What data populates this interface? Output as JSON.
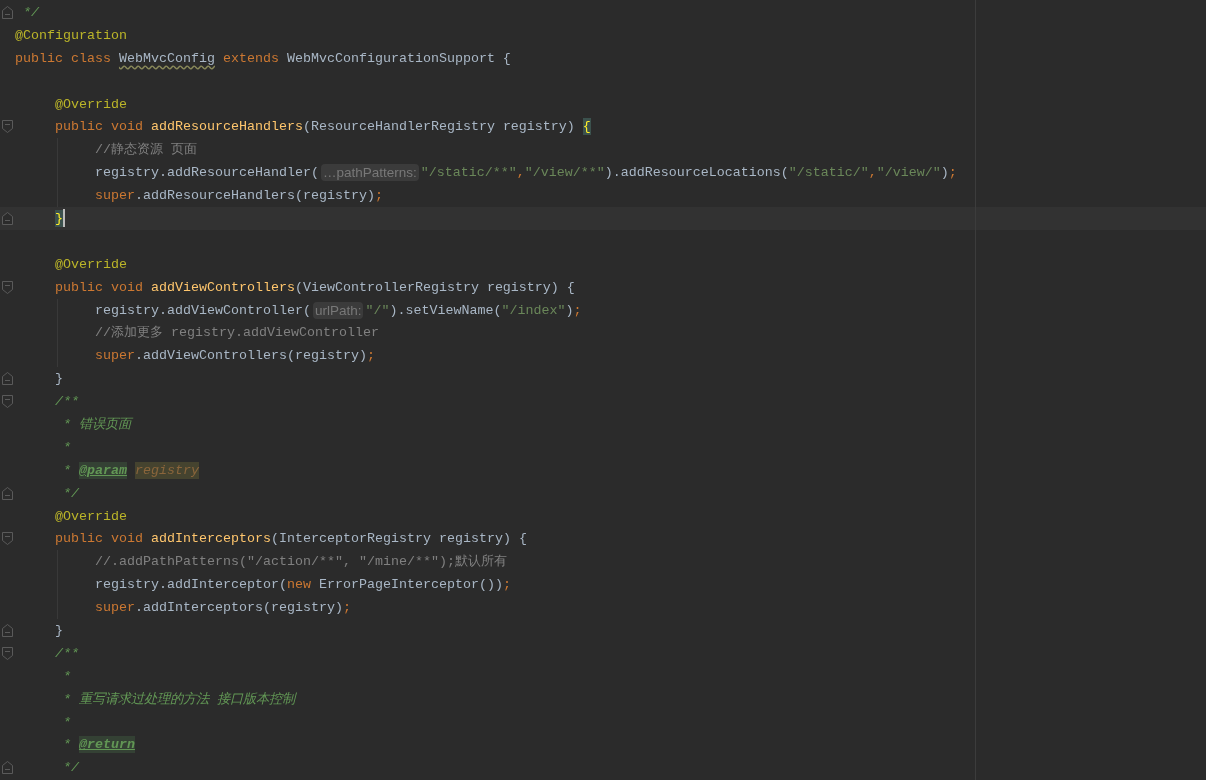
{
  "editor": {
    "lines": [
      {
        "fold_end": true,
        "tokens": [
          {
            "text": "*/",
            "kind": "doc",
            "space": true
          }
        ]
      },
      {
        "tokens": [
          {
            "text": "@Configuration",
            "kind": "annotation"
          }
        ]
      },
      {
        "tokens": [
          {
            "text": "public",
            "kind": "keyword"
          },
          {
            "text": "class",
            "kind": "keyword",
            "space": true
          },
          {
            "text": "WebMvcConfig",
            "kind": "warning",
            "space": true
          },
          {
            "text": "extends",
            "kind": "keyword",
            "space": true
          },
          {
            "text": "WebMvcConfigurationSupport {",
            "kind": "plain",
            "space": true
          }
        ],
        "children": [
          {
            "blank": true
          },
          {
            "tokens": [
              {
                "text": "@Override",
                "kind": "annotation"
              }
            ]
          },
          {
            "fold_start": true,
            "tokens": [
              {
                "text": "public",
                "kind": "keyword"
              },
              {
                "text": "void",
                "kind": "keyword",
                "space": true
              },
              {
                "text": "addResourceHandlers",
                "kind": "method",
                "space": true
              },
              {
                "text": "(ResourceHandlerRegistry registry)",
                "kind": "plain"
              },
              {
                "text": "{",
                "kind": "brace-match",
                "space": true
              }
            ],
            "children": [
              {
                "tokens": [
                  {
                    "text": "//静态资源 页面",
                    "kind": "comment"
                  }
                ]
              },
              {
                "tokens": [
                  {
                    "text": "registry.addResourceHandler(",
                    "kind": "plain"
                  },
                  {
                    "text": "…pathPatterns:",
                    "kind": "hint"
                  },
                  {
                    "text": "\"/static/**\"",
                    "kind": "string"
                  },
                  {
                    "text": ",",
                    "kind": "punct"
                  },
                  {
                    "text": "\"/view/**\"",
                    "kind": "string"
                  },
                  {
                    "text": ").addResourceLocations(",
                    "kind": "plain"
                  },
                  {
                    "text": "\"/static/\"",
                    "kind": "string"
                  },
                  {
                    "text": ",",
                    "kind": "punct"
                  },
                  {
                    "text": "\"/view/\"",
                    "kind": "string"
                  },
                  {
                    "text": ")",
                    "kind": "plain"
                  },
                  {
                    "text": ";",
                    "kind": "punct"
                  }
                ]
              },
              {
                "tokens": [
                  {
                    "text": "super",
                    "kind": "keyword"
                  },
                  {
                    "text": ".addResourceHandlers(registry)",
                    "kind": "plain"
                  },
                  {
                    "text": ";",
                    "kind": "punct"
                  }
                ]
              }
            ]
          },
          {
            "fold_end": true,
            "current": true,
            "tokens": [
              {
                "text": "}",
                "kind": "brace-match"
              }
            ]
          },
          {
            "blank": true
          },
          {
            "tokens": [
              {
                "text": "@Override",
                "kind": "annotation"
              }
            ]
          },
          {
            "fold_start": true,
            "tokens": [
              {
                "text": "public",
                "kind": "keyword"
              },
              {
                "text": "void",
                "kind": "keyword",
                "space": true
              },
              {
                "text": "addViewControllers",
                "kind": "method",
                "space": true
              },
              {
                "text": "(ViewControllerRegistry registry) {",
                "kind": "plain"
              }
            ],
            "children": [
              {
                "tokens": [
                  {
                    "text": "registry.addViewController(",
                    "kind": "plain"
                  },
                  {
                    "text": "urlPath:",
                    "kind": "hint"
                  },
                  {
                    "text": "\"/\"",
                    "kind": "string"
                  },
                  {
                    "text": ").setViewName(",
                    "kind": "plain"
                  },
                  {
                    "text": "\"/index\"",
                    "kind": "string"
                  },
                  {
                    "text": ")",
                    "kind": "plain"
                  },
                  {
                    "text": ";",
                    "kind": "punct"
                  }
                ]
              },
              {
                "tokens": [
                  {
                    "text": "//添加更多 registry.addViewController",
                    "kind": "comment"
                  }
                ]
              },
              {
                "tokens": [
                  {
                    "text": "super",
                    "kind": "keyword"
                  },
                  {
                    "text": ".addViewControllers(registry)",
                    "kind": "plain"
                  },
                  {
                    "text": ";",
                    "kind": "punct"
                  }
                ]
              }
            ]
          },
          {
            "fold_end": true,
            "tokens": [
              {
                "text": "}",
                "kind": "plain"
              }
            ]
          },
          {
            "fold_start": true,
            "tokens": [
              {
                "text": "/**",
                "kind": "doc"
              }
            ]
          },
          {
            "tokens": [
              {
                "text": "* 错误页面",
                "kind": "doc",
                "space": true
              }
            ]
          },
          {
            "tokens": [
              {
                "text": "*",
                "kind": "doc",
                "space": true
              }
            ]
          },
          {
            "tokens": [
              {
                "text": "*",
                "kind": "doc",
                "space": true
              },
              {
                "text": "@param",
                "kind": "doc-tag",
                "space": true
              },
              {
                "text": "registry",
                "kind": "doc-ref",
                "space": true
              }
            ]
          },
          {
            "fold_end": true,
            "tokens": [
              {
                "text": "*/",
                "kind": "doc",
                "space": true
              }
            ]
          },
          {
            "tokens": [
              {
                "text": "@Override",
                "kind": "annotation"
              }
            ]
          },
          {
            "fold_start": true,
            "tokens": [
              {
                "text": "public",
                "kind": "keyword"
              },
              {
                "text": "void",
                "kind": "keyword",
                "space": true
              },
              {
                "text": "addInterceptors",
                "kind": "method",
                "space": true
              },
              {
                "text": "(InterceptorRegistry registry) {",
                "kind": "plain"
              }
            ],
            "children": [
              {
                "tokens": [
                  {
                    "text": "//.addPathPatterns(\"/action/**\", \"/mine/**\");默认所有",
                    "kind": "comment"
                  }
                ]
              },
              {
                "tokens": [
                  {
                    "text": "registry.addInterceptor(",
                    "kind": "plain"
                  },
                  {
                    "text": "new",
                    "kind": "keyword"
                  },
                  {
                    "text": "ErrorPageInterceptor())",
                    "kind": "plain",
                    "space": true
                  },
                  {
                    "text": ";",
                    "kind": "punct"
                  }
                ]
              },
              {
                "tokens": [
                  {
                    "text": "super",
                    "kind": "keyword"
                  },
                  {
                    "text": ".addInterceptors(registry)",
                    "kind": "plain"
                  },
                  {
                    "text": ";",
                    "kind": "punct"
                  }
                ]
              }
            ]
          },
          {
            "fold_end": true,
            "tokens": [
              {
                "text": "}",
                "kind": "plain"
              }
            ]
          },
          {
            "fold_start": true,
            "tokens": [
              {
                "text": "/**",
                "kind": "doc"
              }
            ]
          },
          {
            "tokens": [
              {
                "text": "*",
                "kind": "doc",
                "space": true
              }
            ]
          },
          {
            "tokens": [
              {
                "text": "* 重写请求过处理的方法 接口版本控制",
                "kind": "doc",
                "space": true
              }
            ]
          },
          {
            "tokens": [
              {
                "text": "*",
                "kind": "doc",
                "space": true
              }
            ]
          },
          {
            "tokens": [
              {
                "text": "*",
                "kind": "doc",
                "space": true
              },
              {
                "text": "@return",
                "kind": "doc-tag",
                "space": true
              }
            ]
          },
          {
            "fold_end": true,
            "tokens": [
              {
                "text": "*/",
                "kind": "doc",
                "space": true
              }
            ]
          }
        ]
      }
    ]
  }
}
